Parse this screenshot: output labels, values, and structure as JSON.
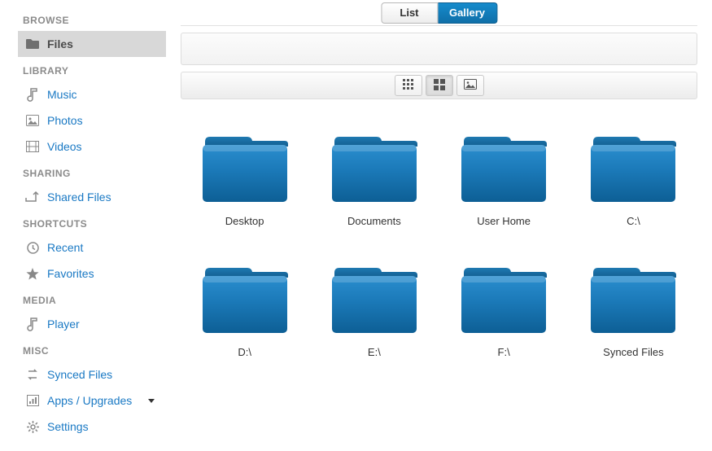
{
  "sidebar": {
    "sections": {
      "browse": {
        "header": "BROWSE",
        "files": "Files"
      },
      "library": {
        "header": "LIBRARY",
        "music": "Music",
        "photos": "Photos",
        "videos": "Videos"
      },
      "sharing": {
        "header": "SHARING",
        "shared_files": "Shared Files"
      },
      "shortcuts": {
        "header": "SHORTCUTS",
        "recent": "Recent",
        "favorites": "Favorites"
      },
      "media": {
        "header": "MEDIA",
        "player": "Player"
      },
      "misc": {
        "header": "MISC",
        "synced_files": "Synced Files",
        "apps_upgrades": "Apps / Upgrades",
        "settings": "Settings"
      }
    }
  },
  "view_tabs": {
    "list": "List",
    "gallery": "Gallery",
    "active": "gallery"
  },
  "view_modes": {
    "small_grid": "small-grid",
    "large_grid": "large-grid",
    "image_view": "image-view",
    "active": "large-grid"
  },
  "gallery": {
    "items": [
      {
        "label": "Desktop"
      },
      {
        "label": "Documents"
      },
      {
        "label": "User Home"
      },
      {
        "label": "C:\\"
      },
      {
        "label": "D:\\"
      },
      {
        "label": "E:\\"
      },
      {
        "label": "F:\\"
      },
      {
        "label": "Synced Files"
      }
    ]
  },
  "colors": {
    "accent": "#1a79c4",
    "tab_active": "#1380bd",
    "folder_top": "#1f7eb8",
    "folder_bottom": "#0d5f95"
  }
}
